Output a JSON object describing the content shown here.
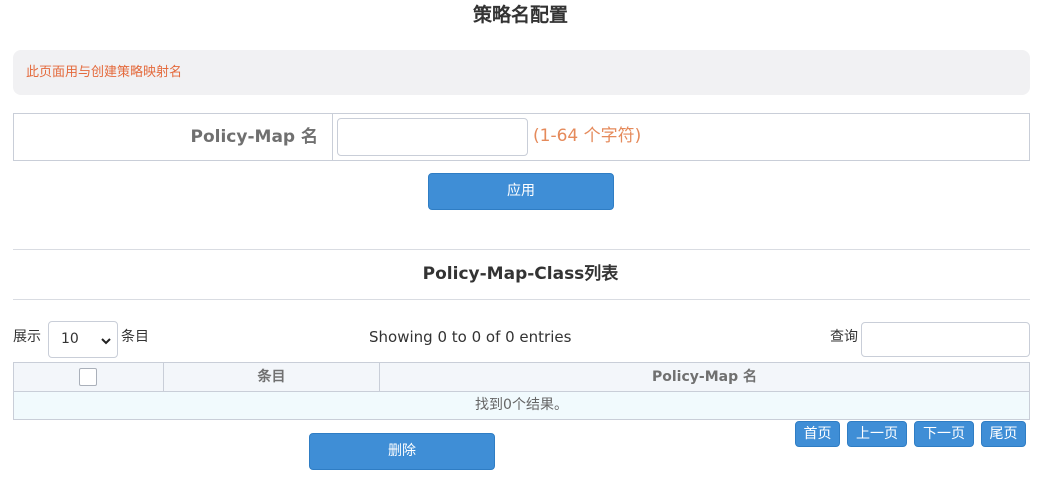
{
  "page": {
    "title": "策略名配置",
    "notice": "此页面用与创建策略映射名"
  },
  "form": {
    "label": "Policy-Map 名",
    "input_value": "",
    "hint": "(1-64 个字符)",
    "apply_label": "应用"
  },
  "list": {
    "title": "Policy-Map-Class列表",
    "show_label": "展示",
    "page_size": "10",
    "page_size_options": [
      "10"
    ],
    "entries_label": "条目",
    "info": "Showing 0 to 0 of 0 entries",
    "search_label": "查询",
    "search_value": "",
    "columns": [
      "",
      "条目",
      "Policy-Map 名"
    ],
    "empty_text": "找到0个结果。",
    "delete_label": "删除"
  },
  "pagination": {
    "first": "首页",
    "prev": "上一页",
    "next": "下一页",
    "last": "尾页"
  },
  "colors": {
    "accent": "#3f8ed6",
    "notice_text": "#e46a3c",
    "hint_text": "#e58a5b",
    "row_empty_bg": "#f1fafd"
  }
}
